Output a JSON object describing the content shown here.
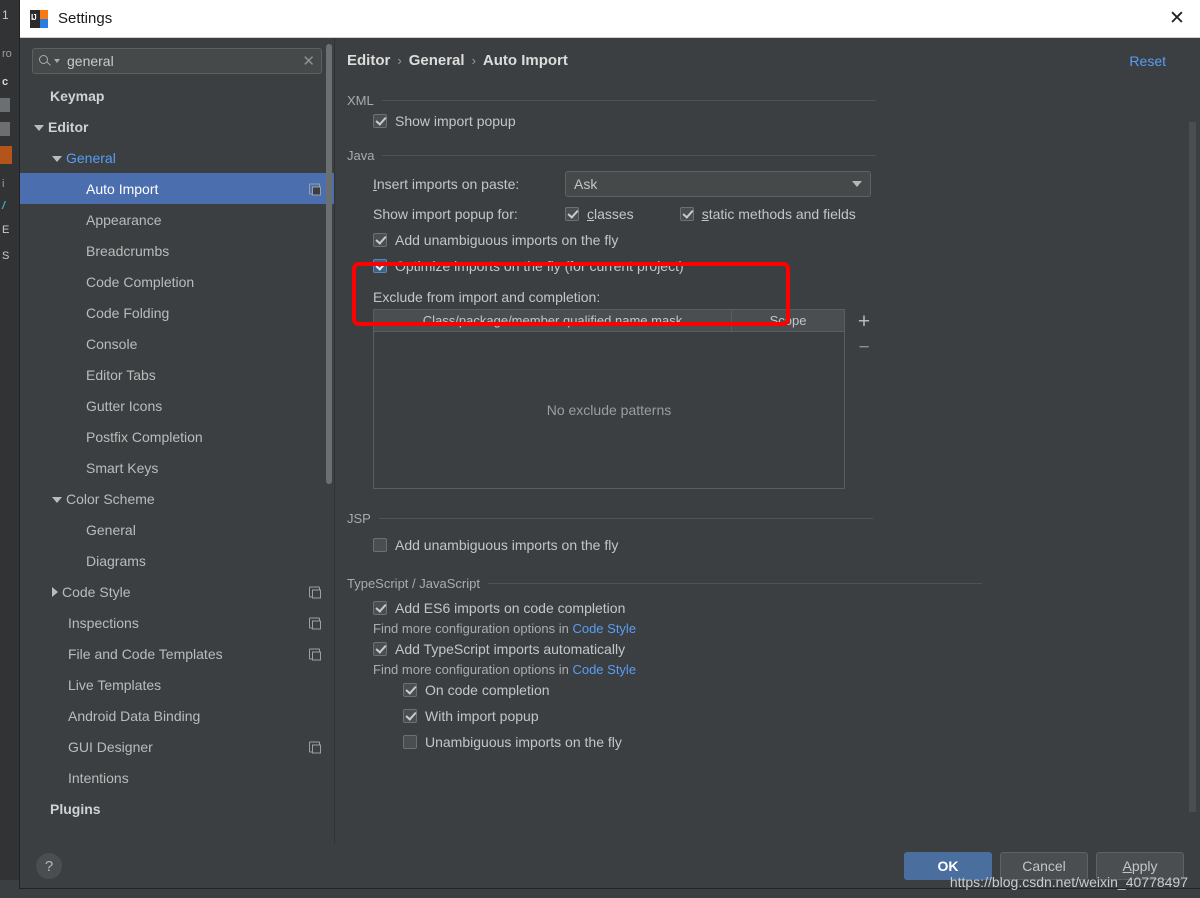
{
  "window": {
    "title": "Settings",
    "app_icon": "intellij-idea-icon",
    "close_label": "✕"
  },
  "search": {
    "value": "general",
    "placeholder": "",
    "clear_label": "✕"
  },
  "sidebar": {
    "items": [
      {
        "label": "Keymap",
        "indent": 0,
        "bold": true,
        "twisty": "none",
        "selected": false,
        "copy": false
      },
      {
        "label": "Editor",
        "indent": 0,
        "bold": true,
        "twisty": "down",
        "selected": false,
        "copy": false
      },
      {
        "label": "General",
        "indent": 1,
        "bold": false,
        "twisty": "down",
        "selected": false,
        "copy": false,
        "link": true
      },
      {
        "label": "Auto Import",
        "indent": 2,
        "bold": false,
        "twisty": "none",
        "selected": true,
        "copy": true
      },
      {
        "label": "Appearance",
        "indent": 2,
        "bold": false,
        "twisty": "none",
        "selected": false,
        "copy": false
      },
      {
        "label": "Breadcrumbs",
        "indent": 2,
        "bold": false,
        "twisty": "none",
        "selected": false,
        "copy": false
      },
      {
        "label": "Code Completion",
        "indent": 2,
        "bold": false,
        "twisty": "none",
        "selected": false,
        "copy": false
      },
      {
        "label": "Code Folding",
        "indent": 2,
        "bold": false,
        "twisty": "none",
        "selected": false,
        "copy": false
      },
      {
        "label": "Console",
        "indent": 2,
        "bold": false,
        "twisty": "none",
        "selected": false,
        "copy": false
      },
      {
        "label": "Editor Tabs",
        "indent": 2,
        "bold": false,
        "twisty": "none",
        "selected": false,
        "copy": false
      },
      {
        "label": "Gutter Icons",
        "indent": 2,
        "bold": false,
        "twisty": "none",
        "selected": false,
        "copy": false
      },
      {
        "label": "Postfix Completion",
        "indent": 2,
        "bold": false,
        "twisty": "none",
        "selected": false,
        "copy": false
      },
      {
        "label": "Smart Keys",
        "indent": 2,
        "bold": false,
        "twisty": "none",
        "selected": false,
        "copy": false
      },
      {
        "label": "Color Scheme",
        "indent": 1,
        "bold": false,
        "twisty": "down",
        "selected": false,
        "copy": false
      },
      {
        "label": "General",
        "indent": 2,
        "bold": false,
        "twisty": "none",
        "selected": false,
        "copy": false
      },
      {
        "label": "Diagrams",
        "indent": 2,
        "bold": false,
        "twisty": "none",
        "selected": false,
        "copy": false
      },
      {
        "label": "Code Style",
        "indent": 1,
        "bold": false,
        "twisty": "right",
        "selected": false,
        "copy": true
      },
      {
        "label": "Inspections",
        "indent": 1,
        "bold": false,
        "twisty": "none",
        "selected": false,
        "copy": true
      },
      {
        "label": "File and Code Templates",
        "indent": 1,
        "bold": false,
        "twisty": "none",
        "selected": false,
        "copy": true
      },
      {
        "label": "Live Templates",
        "indent": 1,
        "bold": false,
        "twisty": "none",
        "selected": false,
        "copy": false
      },
      {
        "label": "Android Data Binding",
        "indent": 1,
        "bold": false,
        "twisty": "none",
        "selected": false,
        "copy": false
      },
      {
        "label": "GUI Designer",
        "indent": 1,
        "bold": false,
        "twisty": "none",
        "selected": false,
        "copy": true
      },
      {
        "label": "Intentions",
        "indent": 1,
        "bold": false,
        "twisty": "none",
        "selected": false,
        "copy": false
      },
      {
        "label": "Plugins",
        "indent": 0,
        "bold": true,
        "twisty": "none",
        "selected": false,
        "copy": false
      }
    ]
  },
  "breadcrumb": {
    "items": [
      "Editor",
      "General",
      "Auto Import"
    ],
    "separator": "›"
  },
  "reset_label": "Reset",
  "sections": {
    "xml": {
      "title": "XML",
      "show_import_popup": {
        "label": "Show import popup",
        "checked": true,
        "style": "grey"
      }
    },
    "java": {
      "title": "Java",
      "insert_imports_label": "Insert imports on paste:",
      "insert_imports_mnemonic": "I",
      "insert_imports_value": "Ask",
      "show_popup_for_label": "Show import popup for:",
      "classes": {
        "label": "classes",
        "mnemonic": "c",
        "checked": true,
        "style": "grey"
      },
      "static_methods": {
        "label": "static methods and fields",
        "mnemonic": "s",
        "checked": true,
        "style": "grey"
      },
      "add_unambiguous": {
        "label": "Add unambiguous imports on the fly",
        "checked": true,
        "style": "grey"
      },
      "optimize_imports": {
        "label": "Optimize imports on the fly (for current project)",
        "checked": true,
        "style": "blue"
      },
      "exclude_label": "Exclude from import and completion:",
      "table": {
        "columns": [
          "Class/package/member qualified name mask",
          "Scope"
        ],
        "rows": [],
        "empty_text": "No exclude patterns",
        "add_label": "+",
        "remove_label": "−"
      }
    },
    "jsp": {
      "title": "JSP",
      "add_unambiguous": {
        "label": "Add unambiguous imports on the fly",
        "checked": false,
        "style": "grey"
      }
    },
    "ts_js": {
      "title": "TypeScript / JavaScript",
      "add_es6": {
        "label": "Add ES6 imports on code completion",
        "checked": true,
        "style": "grey"
      },
      "hint1_prefix": "Find more configuration options in ",
      "hint1_link": "Code Style",
      "add_ts": {
        "label": "Add TypeScript imports automatically",
        "checked": true,
        "style": "grey"
      },
      "hint2_prefix": "Find more configuration options in ",
      "hint2_link": "Code Style",
      "on_code_completion": {
        "label": "On code completion",
        "checked": true,
        "style": "grey"
      },
      "with_import_popup": {
        "label": "With import popup",
        "checked": true,
        "style": "grey"
      },
      "unambiguous_on_fly": {
        "label": "Unambiguous imports on the fly",
        "checked": false,
        "style": "grey"
      }
    }
  },
  "footer": {
    "help_label": "?",
    "ok_label": "OK",
    "cancel_label": "Cancel",
    "apply_label": "Apply",
    "apply_mnemonic": "A"
  },
  "watermark": "https://blog.csdn.net/weixin_40778497",
  "annotation": {
    "color": "#ff0000",
    "targets": [
      "Add unambiguous imports on the fly",
      "Optimize imports on the fly (for current project)"
    ]
  },
  "background_ide": {
    "left_fragments": [
      "1",
      ",",
      "ro",
      "c",
      "",
      "",
      "",
      "i",
      "/",
      "E",
      "S"
    ]
  },
  "colors": {
    "accent_blue": "#4b6eaf",
    "link_blue": "#589df6",
    "panel_bg": "#3c3f41",
    "annotation_red": "#ff0000"
  }
}
